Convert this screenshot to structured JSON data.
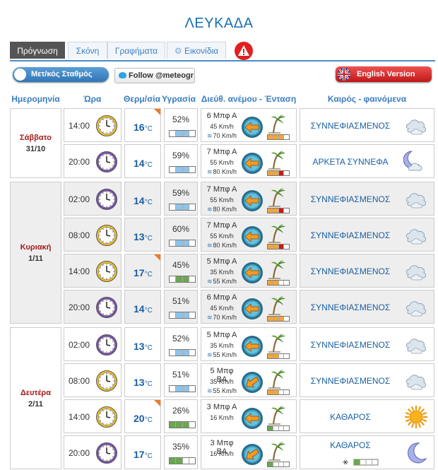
{
  "title": "ΛΕΥΚΑΔΑ",
  "tabs": [
    {
      "label": "Πρόγνωση",
      "active": true
    },
    {
      "label": "Σκόνη",
      "active": false
    },
    {
      "label": "Γραφήματα",
      "active": false
    },
    {
      "label": "Εικονίδια",
      "active": false
    }
  ],
  "buttons": {
    "station": "Μετ/κός Σταθμός",
    "follow": "Follow @meteogr",
    "english": "English Version"
  },
  "headers": {
    "date": "Ημερομηνία",
    "time": "Ώρα",
    "temp": "Θερμ/σία",
    "humidity": "Υγρασία",
    "wind": "Διεύθ. ανέμου - Ένταση",
    "weather": "Καιρός - φαινόμενα"
  },
  "temp_unit": "°C",
  "colors": {
    "accent": "#1a6fb5",
    "day": "#a51b1b",
    "warning": "#e02020"
  },
  "days": [
    {
      "day": "Σάββατο",
      "date": "31/10",
      "rows": [
        {
          "time": "14:00",
          "clock": "day",
          "temp": "16",
          "hot": true,
          "hum": "52%",
          "hum_bar": [
            "",
            "b",
            "b",
            ""
          ],
          "bf": "6 Μπφ Α",
          "speed": "45 Km/h",
          "gust": "70 Km/h",
          "arrow_deg": 0,
          "wbar": [
            "y",
            "y",
            "y",
            ""
          ],
          "weather": "ΣΥΝΝΕΦΙΑΣΜΕΝΟΣ",
          "icon": "cloud-icon"
        },
        {
          "time": "20:00",
          "clock": "night",
          "temp": "14",
          "hot": false,
          "hum": "59%",
          "hum_bar": [
            "",
            "b",
            "b",
            ""
          ],
          "bf": "7 Μπφ Α",
          "speed": "55 Km/h",
          "gust": "80 Km/h",
          "arrow_deg": 0,
          "wbar": [
            "y",
            "y",
            "r",
            ""
          ],
          "weather": "ΑΡΚΕΤΑ ΣΥΝΝΕΦΑ",
          "icon": "moon-cloud-icon"
        }
      ]
    },
    {
      "day": "Κυριακή",
      "date": "1/11",
      "rows": [
        {
          "time": "02:00",
          "clock": "night",
          "temp": "14",
          "hot": false,
          "hum": "59%",
          "hum_bar": [
            "",
            "b",
            "b",
            ""
          ],
          "bf": "7 Μπφ Α",
          "speed": "55 Km/h",
          "gust": "80 Km/h",
          "arrow_deg": 0,
          "wbar": [
            "y",
            "y",
            "r",
            ""
          ],
          "weather": "ΣΥΝΝΕΦΙΑΣΜΕΝΟΣ",
          "icon": "cloud-icon"
        },
        {
          "time": "08:00",
          "clock": "day",
          "temp": "13",
          "hot": false,
          "hum": "60%",
          "hum_bar": [
            "",
            "b",
            "b",
            ""
          ],
          "bf": "7 Μπφ Α",
          "speed": "55 Km/h",
          "gust": "80 Km/h",
          "arrow_deg": 0,
          "wbar": [
            "y",
            "y",
            "r",
            ""
          ],
          "weather": "ΣΥΝΝΕΦΙΑΣΜΕΝΟΣ",
          "icon": "cloud-icon"
        },
        {
          "time": "14:00",
          "clock": "day",
          "temp": "17",
          "hot": true,
          "hum": "45%",
          "hum_bar": [
            "",
            "g",
            "g",
            ""
          ],
          "bf": "5 Μπφ Α",
          "speed": "35 Km/h",
          "gust": "55 Km/h",
          "arrow_deg": 0,
          "wbar": [
            "y",
            "y",
            "",
            ""
          ],
          "weather": "ΣΥΝΝΕΦΙΑΣΜΕΝΟΣ",
          "icon": "cloud-icon"
        },
        {
          "time": "20:00",
          "clock": "night",
          "temp": "14",
          "hot": false,
          "hum": "51%",
          "hum_bar": [
            "",
            "b",
            "b",
            ""
          ],
          "bf": "6 Μπφ Α",
          "speed": "45 Km/h",
          "gust": "70 Km/h",
          "arrow_deg": 0,
          "wbar": [
            "y",
            "y",
            "y",
            ""
          ],
          "weather": "ΣΥΝΝΕΦΙΑΣΜΕΝΟΣ",
          "icon": "cloud-icon"
        }
      ]
    },
    {
      "day": "Δευτέρα",
      "date": "2/11",
      "rows": [
        {
          "time": "02:00",
          "clock": "night",
          "temp": "13",
          "hot": false,
          "hum": "52%",
          "hum_bar": [
            "",
            "b",
            "b",
            ""
          ],
          "bf": "5 Μπφ Α",
          "speed": "35 Km/h",
          "gust": "55 Km/h",
          "arrow_deg": 0,
          "wbar": [
            "y",
            "y",
            "",
            ""
          ],
          "weather": "ΣΥΝΝΕΦΙΑΣΜΕΝΟΣ",
          "icon": "cloud-icon"
        },
        {
          "time": "08:00",
          "clock": "day",
          "temp": "13",
          "hot": false,
          "hum": "51%",
          "hum_bar": [
            "",
            "b",
            "b",
            ""
          ],
          "bf": "5 Μπφ ΒΑ",
          "speed": "35 Km/h",
          "gust": "55 Km/h",
          "arrow_deg": -35,
          "wbar": [
            "y",
            "y",
            "",
            ""
          ],
          "weather": "ΣΥΝΝΕΦΙΑΣΜΕΝΟΣ",
          "icon": "cloud-icon"
        },
        {
          "time": "14:00",
          "clock": "day",
          "temp": "20",
          "hot": true,
          "hum": "26%",
          "hum_bar": [
            "g",
            "g",
            "g",
            ""
          ],
          "bf": "3 Μπφ Α",
          "speed": "16 Km/h",
          "gust": "",
          "arrow_deg": 0,
          "wbar": [
            "g",
            "",
            "",
            ""
          ],
          "weather": "ΚΑΘΑΡΟΣ",
          "icon": "sun-icon"
        },
        {
          "time": "20:00",
          "clock": "night",
          "temp": "17",
          "hot": false,
          "hum": "35%",
          "hum_bar": [
            "g",
            "g",
            "",
            ""
          ],
          "bf": "3 Μπφ ΒΑ",
          "speed": "16 Km/h",
          "gust": "",
          "arrow_deg": -35,
          "wbar": [
            "g",
            "",
            "",
            ""
          ],
          "weather": "ΚΑΘΑΡΟΣ",
          "icon": "moon-icon",
          "mosquito": true
        }
      ]
    }
  ]
}
